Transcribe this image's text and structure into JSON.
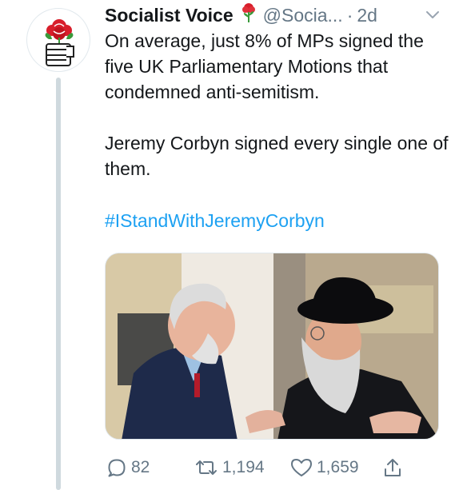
{
  "tweet": {
    "display_name": "Socialist Voice",
    "handle": "@Socia...",
    "dot": "·",
    "time": "2d",
    "paragraph1": "On average, just 8% of MPs signed the five UK Parliamentary Motions that condemned anti-semitism.",
    "paragraph2": "Jeremy Corbyn signed every single one of them.",
    "hashtag": "#IStandWithJeremyCorbyn"
  },
  "actions": {
    "replies": "82",
    "retweets": "1,194",
    "likes": "1,659"
  },
  "icons": {
    "avatar": "fist-and-rose-logo",
    "name_badge": "rose-icon",
    "menu": "chevron-down-icon",
    "reply": "reply-icon",
    "retweet": "retweet-icon",
    "like": "heart-icon",
    "share": "share-icon"
  },
  "colors": {
    "link": "#1da1f2",
    "muted": "#657786",
    "rose": "#d81e2b"
  }
}
